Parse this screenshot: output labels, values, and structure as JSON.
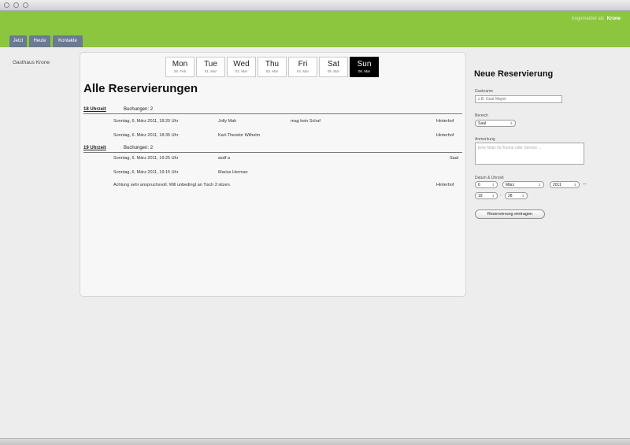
{
  "header": {
    "user_prefix": "Angemeldet als",
    "user_name": "Krone"
  },
  "nav": {
    "tabs": [
      {
        "label": "Jetzt"
      },
      {
        "label": "Heute"
      },
      {
        "label": "Kontakte"
      }
    ]
  },
  "sidebar": {
    "restaurant_name": "Gasthaus Krone"
  },
  "days": [
    {
      "name": "Mon",
      "date": "28. Feb"
    },
    {
      "name": "Tue",
      "date": "01. Mar"
    },
    {
      "name": "Wed",
      "date": "02. Mar"
    },
    {
      "name": "Thu",
      "date": "03. Mar"
    },
    {
      "name": "Fri",
      "date": "04. Mar"
    },
    {
      "name": "Sat",
      "date": "05. Mar"
    },
    {
      "name": "Sun",
      "date": "06. Mar",
      "active": true
    }
  ],
  "list": {
    "title": "Alle Reservierungen",
    "slots": [
      {
        "time": "18 Uhrzeit",
        "count": "Buchungen: 2",
        "rows": [
          {
            "date": "Sonntag, 6. März 2011, 18:20 Uhr",
            "name": "Jolly Mah",
            "note": "mag kein Schaf",
            "area": "Hinterhof"
          },
          {
            "date": "Sonntag, 6. März 2011, 18:35 Uhr",
            "name": "Karl-Theodor Wilhelm",
            "note": "",
            "area": "Hinterhof"
          }
        ]
      },
      {
        "time": "19 Uhrzeit",
        "count": "Buchungen: 2",
        "rows": [
          {
            "date": "Sonntag, 6. März 2011, 19:25 Uhr",
            "name": "asdf a",
            "note": "",
            "area": "Saal"
          },
          {
            "date": "Sonntag, 6. März 2011, 19:15 Uhr",
            "name": "Marius Herman",
            "note": "",
            "area": ""
          },
          {
            "date": "Achtung sehr anspruchsvoll. Will unbedingt an Tisch 3 sitzen.",
            "name": "",
            "note": "",
            "area": "Hinterhof"
          }
        ]
      }
    ]
  },
  "form": {
    "title": "Neue Reservierung",
    "guest_label": "Gastname",
    "guest_placeholder": "z.B. Gast Mayer",
    "area_label": "Bereich",
    "area_value": "Saal",
    "note_label": "Anmerkung",
    "note_placeholder": "Eine Notiz für Küche oder Service ...",
    "date_label": "Datum & Uhrzeit",
    "day_value": "6",
    "month_value": "März",
    "year_value": "2011",
    "date_sep": "—",
    "hour_value": "19",
    "minute_value": "28",
    "time_sep": ":",
    "submit_label": "Reservierung eintragen"
  },
  "colors": {
    "header_green": "#8cc63f",
    "tab_slate": "#6a7a91",
    "active_day": "#000000"
  }
}
